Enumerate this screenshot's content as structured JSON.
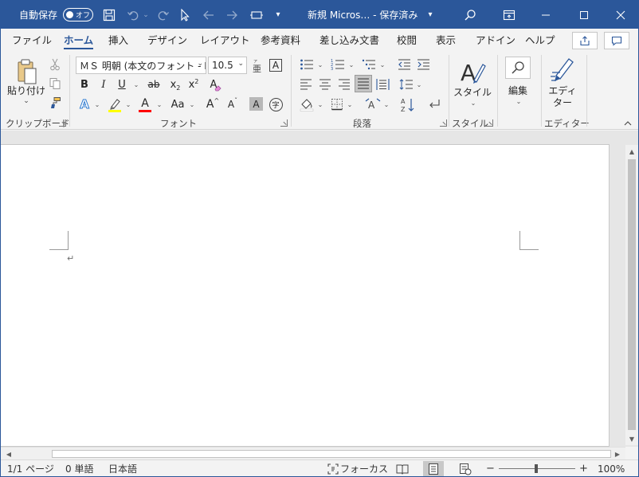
{
  "titlebar": {
    "autosave_label": "自動保存",
    "autosave_state": "オフ",
    "doc_title": "新規 Micros… - 保存済み",
    "title_chevron": "▾",
    "icons": [
      "save-icon",
      "undo-icon",
      "redo-icon",
      "pointer-icon",
      "back-icon",
      "forward-icon",
      "touch-mode-icon",
      "customize-qat-icon",
      "search-icon",
      "ribbon-display-icon",
      "minimize-icon",
      "maximize-icon",
      "close-icon"
    ]
  },
  "tabs": [
    "ファイル",
    "ホーム",
    "挿入",
    "デザイン",
    "レイアウト",
    "参考資料",
    "差し込み文書",
    "校閲",
    "表示",
    "アドイン",
    "ヘルプ"
  ],
  "active_tab": "ホーム",
  "ribbon": {
    "clipboard": {
      "paste_label": "貼り付け",
      "chevron": "⌄",
      "group_label": "クリップボード"
    },
    "font": {
      "font_name": "ＭＳ 明朝 (本文のフォント - E",
      "font_size": "10.5",
      "font_size_chevron": "⌄",
      "bold": "B",
      "italic": "I",
      "underline": "U",
      "strikethrough": "ab",
      "subscript": "x",
      "subscript_mark": "2",
      "superscript": "x",
      "superscript_mark": "2",
      "text_effect": "A",
      "highlight_color": "#ffff00",
      "font_color": "#ff0000",
      "font_color_glyph": "A",
      "change_case": "Aa",
      "grow_font": "A",
      "shrink_font": "A",
      "char_shading": "A",
      "enclose_char": "字",
      "ruby": "A",
      "char_border": "A",
      "clear_format": "A",
      "group_label": "フォント"
    },
    "paragraph": {
      "group_label": "段落"
    },
    "styles": {
      "label": "スタイル",
      "group_label": "スタイル"
    },
    "editing": {
      "label": "編集"
    },
    "editor": {
      "label_line1": "エディ",
      "label_line2": "ター",
      "group_label": "エディター"
    }
  },
  "document": {
    "paragraph_mark": "↵"
  },
  "statusbar": {
    "page": "1/1 ページ",
    "words": "0 単語",
    "language": "日本語",
    "focus": "フォーカス",
    "zoom_minus": "−",
    "zoom_plus": "+",
    "zoom": "100%"
  },
  "colors": {
    "accent": "#2b579a",
    "background": "#f3f3f3",
    "page": "#ffffff"
  }
}
